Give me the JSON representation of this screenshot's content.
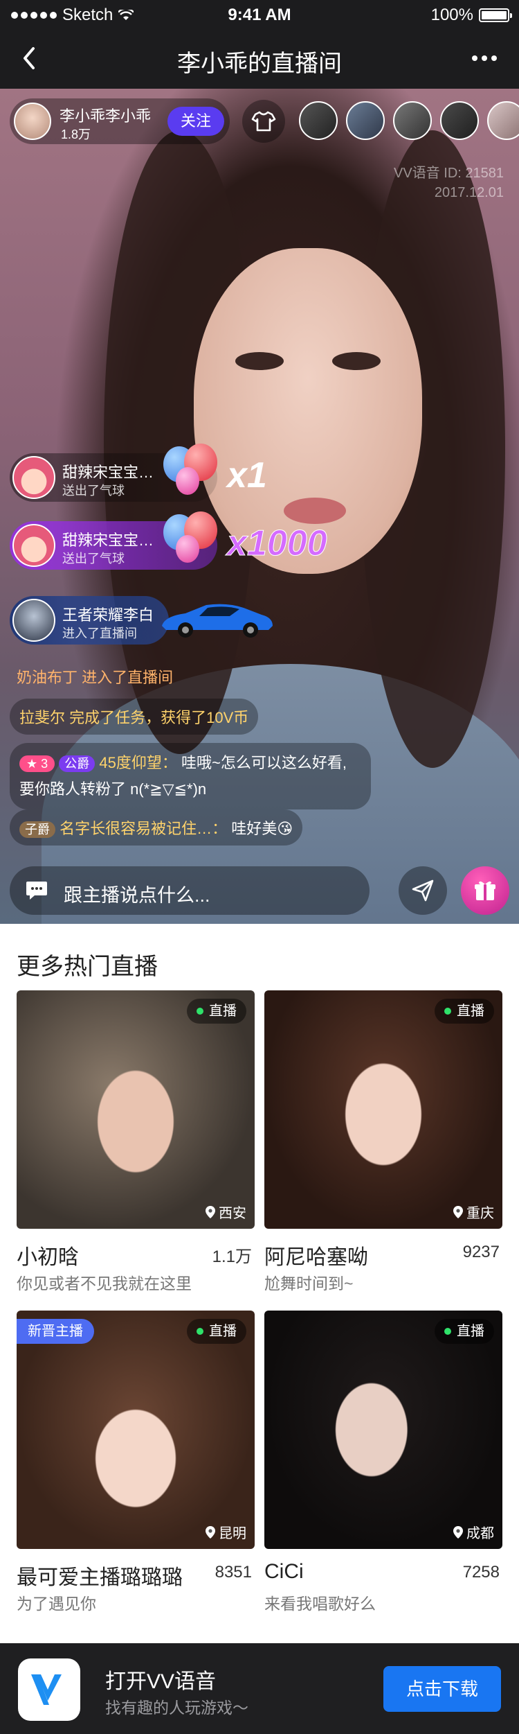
{
  "status_bar": {
    "carrier": "Sketch",
    "time": "9:41 AM",
    "battery": "100%"
  },
  "nav": {
    "title": "李小乖的直播间"
  },
  "host": {
    "name": "李小乖李小乖",
    "fans": "1.8万",
    "follow_label": "关注"
  },
  "watermark": {
    "id": "VV语音 ID: 21581",
    "date": "2017.12.01"
  },
  "gifts": [
    {
      "name": "甜辣宋宝宝宝宝",
      "action": "送出了气球",
      "count": "x1"
    },
    {
      "name": "甜辣宋宝宝宝宝",
      "action": "送出了气球",
      "count": "x1000"
    }
  ],
  "car_entry": {
    "name": "王者荣耀李白",
    "action": "进入了直播间"
  },
  "chat": {
    "enter": {
      "user": "奶油布丁",
      "text": "进入了直播间"
    },
    "task": {
      "user": "拉斐尔",
      "text": "完成了任务，获得了10V币"
    },
    "msg1": {
      "level": "3",
      "title": "公爵",
      "user": "45度仰望：",
      "line1": "哇哦~怎么可以这么好看,",
      "line2": "要你路人转粉了 n(*≧▽≦*)n"
    },
    "msg2": {
      "title": "子爵",
      "user": "名字长很容易被记住…：",
      "text": "哇好美😘"
    }
  },
  "input": {
    "placeholder": "跟主播说点什么..."
  },
  "more": {
    "title": "更多热门直播",
    "live_tag": "直播",
    "new_tag": "新晋主播",
    "cards": [
      {
        "name": "小初晗",
        "count": "1.1万",
        "desc": "你见或者不见我就在这里",
        "location": "西安"
      },
      {
        "name": "阿尼哈塞呦",
        "count": "9237",
        "desc": "尬舞时间到~",
        "location": "重庆"
      },
      {
        "name": "最可爱主播璐璐璐",
        "count": "8351",
        "desc": "为了遇见你",
        "location": "昆明"
      },
      {
        "name": "CiCi",
        "count": "7258",
        "desc": "来看我唱歌好么",
        "location": "成都"
      }
    ]
  },
  "download": {
    "title": "打开VV语音",
    "subtitle": "找有趣的人玩游戏～",
    "button": "点击下载"
  }
}
